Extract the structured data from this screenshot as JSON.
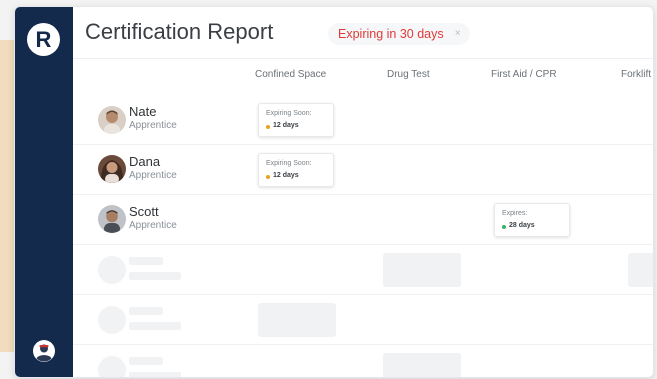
{
  "app": {
    "logo_letter": "R"
  },
  "header": {
    "title": "Certification Report",
    "filter_chip": {
      "label": "Expiring in 30 days",
      "close_glyph": "×"
    }
  },
  "columns": [
    "Confined Space",
    "Drug Test",
    "First Aid / CPR",
    "Forklift"
  ],
  "people": [
    {
      "name": "Nate",
      "role": "Apprentice",
      "cert": {
        "column": "Confined Space",
        "status": "Expiring Soon:",
        "days": "12 days",
        "dot_color": "#f0a020"
      }
    },
    {
      "name": "Dana",
      "role": "Apprentice",
      "cert": {
        "column": "Confined Space",
        "status": "Expiring Soon:",
        "days": "12 days",
        "dot_color": "#f0a020"
      }
    },
    {
      "name": "Scott",
      "role": "Apprentice",
      "cert": {
        "column": "First Aid / CPR",
        "status": "Expires:",
        "days": "28 days",
        "dot_color": "#3bb26b"
      }
    }
  ],
  "colors": {
    "sidebar": "#132a4c",
    "accent_red": "#e03a3a",
    "warning_orange": "#f0a020",
    "ok_green": "#3bb26b",
    "beige": "#f2dcbd"
  },
  "icons": {
    "logo": "r-logo-icon",
    "user": "user-avatar-icon",
    "close": "close-icon"
  }
}
